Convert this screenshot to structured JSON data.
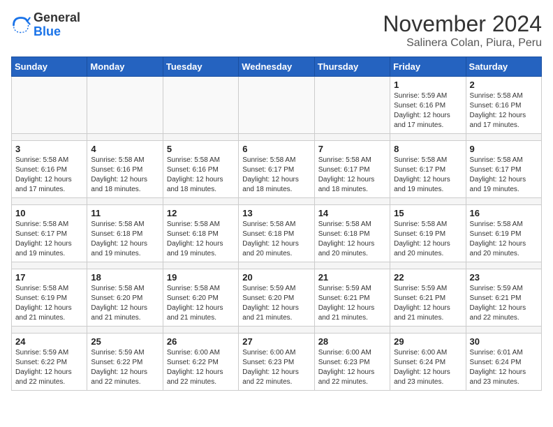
{
  "header": {
    "logo_general": "General",
    "logo_blue": "Blue",
    "title": "November 2024",
    "subtitle": "Salinera Colan, Piura, Peru"
  },
  "weekdays": [
    "Sunday",
    "Monday",
    "Tuesday",
    "Wednesday",
    "Thursday",
    "Friday",
    "Saturday"
  ],
  "weeks": [
    [
      {
        "day": "",
        "info": ""
      },
      {
        "day": "",
        "info": ""
      },
      {
        "day": "",
        "info": ""
      },
      {
        "day": "",
        "info": ""
      },
      {
        "day": "",
        "info": ""
      },
      {
        "day": "1",
        "info": "Sunrise: 5:59 AM\nSunset: 6:16 PM\nDaylight: 12 hours and 17 minutes."
      },
      {
        "day": "2",
        "info": "Sunrise: 5:58 AM\nSunset: 6:16 PM\nDaylight: 12 hours and 17 minutes."
      }
    ],
    [
      {
        "day": "3",
        "info": "Sunrise: 5:58 AM\nSunset: 6:16 PM\nDaylight: 12 hours and 17 minutes."
      },
      {
        "day": "4",
        "info": "Sunrise: 5:58 AM\nSunset: 6:16 PM\nDaylight: 12 hours and 18 minutes."
      },
      {
        "day": "5",
        "info": "Sunrise: 5:58 AM\nSunset: 6:16 PM\nDaylight: 12 hours and 18 minutes."
      },
      {
        "day": "6",
        "info": "Sunrise: 5:58 AM\nSunset: 6:17 PM\nDaylight: 12 hours and 18 minutes."
      },
      {
        "day": "7",
        "info": "Sunrise: 5:58 AM\nSunset: 6:17 PM\nDaylight: 12 hours and 18 minutes."
      },
      {
        "day": "8",
        "info": "Sunrise: 5:58 AM\nSunset: 6:17 PM\nDaylight: 12 hours and 19 minutes."
      },
      {
        "day": "9",
        "info": "Sunrise: 5:58 AM\nSunset: 6:17 PM\nDaylight: 12 hours and 19 minutes."
      }
    ],
    [
      {
        "day": "10",
        "info": "Sunrise: 5:58 AM\nSunset: 6:17 PM\nDaylight: 12 hours and 19 minutes."
      },
      {
        "day": "11",
        "info": "Sunrise: 5:58 AM\nSunset: 6:18 PM\nDaylight: 12 hours and 19 minutes."
      },
      {
        "day": "12",
        "info": "Sunrise: 5:58 AM\nSunset: 6:18 PM\nDaylight: 12 hours and 19 minutes."
      },
      {
        "day": "13",
        "info": "Sunrise: 5:58 AM\nSunset: 6:18 PM\nDaylight: 12 hours and 20 minutes."
      },
      {
        "day": "14",
        "info": "Sunrise: 5:58 AM\nSunset: 6:18 PM\nDaylight: 12 hours and 20 minutes."
      },
      {
        "day": "15",
        "info": "Sunrise: 5:58 AM\nSunset: 6:19 PM\nDaylight: 12 hours and 20 minutes."
      },
      {
        "day": "16",
        "info": "Sunrise: 5:58 AM\nSunset: 6:19 PM\nDaylight: 12 hours and 20 minutes."
      }
    ],
    [
      {
        "day": "17",
        "info": "Sunrise: 5:58 AM\nSunset: 6:19 PM\nDaylight: 12 hours and 21 minutes."
      },
      {
        "day": "18",
        "info": "Sunrise: 5:58 AM\nSunset: 6:20 PM\nDaylight: 12 hours and 21 minutes."
      },
      {
        "day": "19",
        "info": "Sunrise: 5:58 AM\nSunset: 6:20 PM\nDaylight: 12 hours and 21 minutes."
      },
      {
        "day": "20",
        "info": "Sunrise: 5:59 AM\nSunset: 6:20 PM\nDaylight: 12 hours and 21 minutes."
      },
      {
        "day": "21",
        "info": "Sunrise: 5:59 AM\nSunset: 6:21 PM\nDaylight: 12 hours and 21 minutes."
      },
      {
        "day": "22",
        "info": "Sunrise: 5:59 AM\nSunset: 6:21 PM\nDaylight: 12 hours and 21 minutes."
      },
      {
        "day": "23",
        "info": "Sunrise: 5:59 AM\nSunset: 6:21 PM\nDaylight: 12 hours and 22 minutes."
      }
    ],
    [
      {
        "day": "24",
        "info": "Sunrise: 5:59 AM\nSunset: 6:22 PM\nDaylight: 12 hours and 22 minutes."
      },
      {
        "day": "25",
        "info": "Sunrise: 5:59 AM\nSunset: 6:22 PM\nDaylight: 12 hours and 22 minutes."
      },
      {
        "day": "26",
        "info": "Sunrise: 6:00 AM\nSunset: 6:22 PM\nDaylight: 12 hours and 22 minutes."
      },
      {
        "day": "27",
        "info": "Sunrise: 6:00 AM\nSunset: 6:23 PM\nDaylight: 12 hours and 22 minutes."
      },
      {
        "day": "28",
        "info": "Sunrise: 6:00 AM\nSunset: 6:23 PM\nDaylight: 12 hours and 22 minutes."
      },
      {
        "day": "29",
        "info": "Sunrise: 6:00 AM\nSunset: 6:24 PM\nDaylight: 12 hours and 23 minutes."
      },
      {
        "day": "30",
        "info": "Sunrise: 6:01 AM\nSunset: 6:24 PM\nDaylight: 12 hours and 23 minutes."
      }
    ]
  ]
}
